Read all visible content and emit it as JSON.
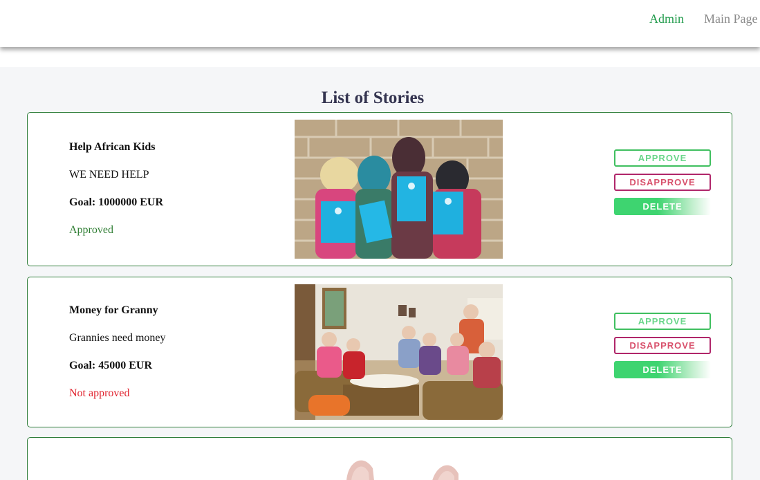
{
  "nav": {
    "admin_label": "Admin",
    "main_label": "Main Page"
  },
  "page": {
    "title": "List of Stories"
  },
  "stories": [
    {
      "title": "Help African Kids",
      "description": "WE NEED HELP",
      "goal": "Goal: 1000000 EUR",
      "status": "Approved",
      "image_alt": "children-with-unicef-notebooks",
      "approve_label": "APPROVE",
      "disapprove_label": "DISAPPROVE",
      "delete_label": "DELETE"
    },
    {
      "title": "Money for Granny",
      "description": "Grannies need money",
      "goal": "Goal: 45000 EUR",
      "status": "Not approved",
      "image_alt": "seniors-waving-in-living-room",
      "approve_label": "APPROVE",
      "disapprove_label": "DISAPPROVE",
      "delete_label": "DELETE"
    }
  ],
  "colors": {
    "accent_green": "#1f9a4a",
    "card_border": "#2e7d3a",
    "approved": "#2e7d32",
    "not_approved": "#e0202c",
    "disapprove": "#b0266a"
  }
}
